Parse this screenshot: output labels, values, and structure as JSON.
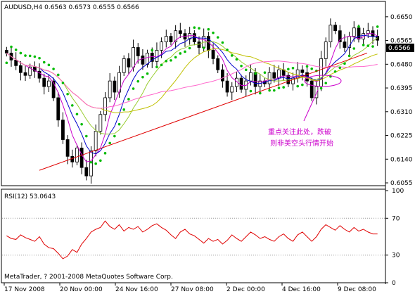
{
  "chart_data": [
    {
      "type": "candlestick",
      "title": "AUDUSD,H4  0.6563 0.6573 0.6555 0.6566",
      "symbol": "AUDUSD",
      "timeframe": "H4",
      "ohlc_header": "0.6563 0.6573 0.6555 0.6566",
      "current_price": "0.6566",
      "y_ticks": [
        "0.6650",
        "0.6565",
        "0.6480",
        "0.6395",
        "0.6310",
        "0.6225",
        "0.6140",
        "0.6055"
      ],
      "ylim": [
        0.605,
        0.67
      ],
      "x_ticks": [
        "17 Nov 2008",
        "20 Nov 00:00",
        "24 Nov 16:00",
        "27 Nov 08:00",
        "2 Dec 00:00",
        "4 Dec 16:00",
        "9 Dec 08:00"
      ],
      "indicators": [
        "Moving averages",
        "Parabolic SAR",
        "Trend line"
      ],
      "annotation": {
        "line1": "重点关注此处，跌破",
        "line2": "则非美空头行情开始"
      },
      "closes": [
        0.652,
        0.6495,
        0.6475,
        0.645,
        0.644,
        0.647,
        0.6455,
        0.643,
        0.64,
        0.642,
        0.636,
        0.628,
        0.621,
        0.615,
        0.613,
        0.618,
        0.611,
        0.608,
        0.617,
        0.624,
        0.63,
        0.636,
        0.642,
        0.638,
        0.645,
        0.65,
        0.647,
        0.654,
        0.651,
        0.648,
        0.652,
        0.649,
        0.653,
        0.656,
        0.658,
        0.656,
        0.66,
        0.659,
        0.657,
        0.659,
        0.656,
        0.654,
        0.658,
        0.653,
        0.65,
        0.646,
        0.642,
        0.638,
        0.64,
        0.643,
        0.639,
        0.642,
        0.645,
        0.64,
        0.642,
        0.641,
        0.645,
        0.643,
        0.646,
        0.644,
        0.641,
        0.643,
        0.646,
        0.645,
        0.642,
        0.636,
        0.64,
        0.65,
        0.656,
        0.662,
        0.66,
        0.656,
        0.654,
        0.658,
        0.661,
        0.657,
        0.659,
        0.66,
        0.658,
        0.6566
      ]
    },
    {
      "type": "line",
      "title": "RSI(12) 53.0643",
      "indicator": "RSI(12)",
      "value": "53.0643",
      "y_ticks": [
        "100",
        "70",
        "30",
        "0"
      ],
      "ylim": [
        0,
        100
      ],
      "values": [
        51,
        48,
        47,
        52,
        49,
        47,
        45,
        50,
        42,
        38,
        37,
        32,
        26,
        29,
        36,
        33,
        42,
        48,
        55,
        58,
        60,
        67,
        61,
        58,
        63,
        56,
        60,
        58,
        61,
        55,
        58,
        62,
        64,
        60,
        57,
        52,
        48,
        55,
        58,
        53,
        51,
        47,
        43,
        48,
        45,
        47,
        42,
        46,
        52,
        48,
        45,
        50,
        55,
        52,
        48,
        50,
        47,
        45,
        50,
        53,
        48,
        45,
        52,
        55,
        50,
        45,
        50,
        58,
        63,
        60,
        57,
        62,
        58,
        55,
        60,
        56,
        58,
        55,
        53,
        53
      ]
    }
  ],
  "footer": {
    "copyright": "MetaTrader, ? 2001-2008 MetaQuotes Software Corp."
  },
  "colors": {
    "bull": "#ffffff",
    "bear": "#000000",
    "trendline": "#e00000",
    "sar": "#00bb00",
    "rsi": "#e00000",
    "annotation": "#cc00cc",
    "current_price_bg": "#000000"
  }
}
